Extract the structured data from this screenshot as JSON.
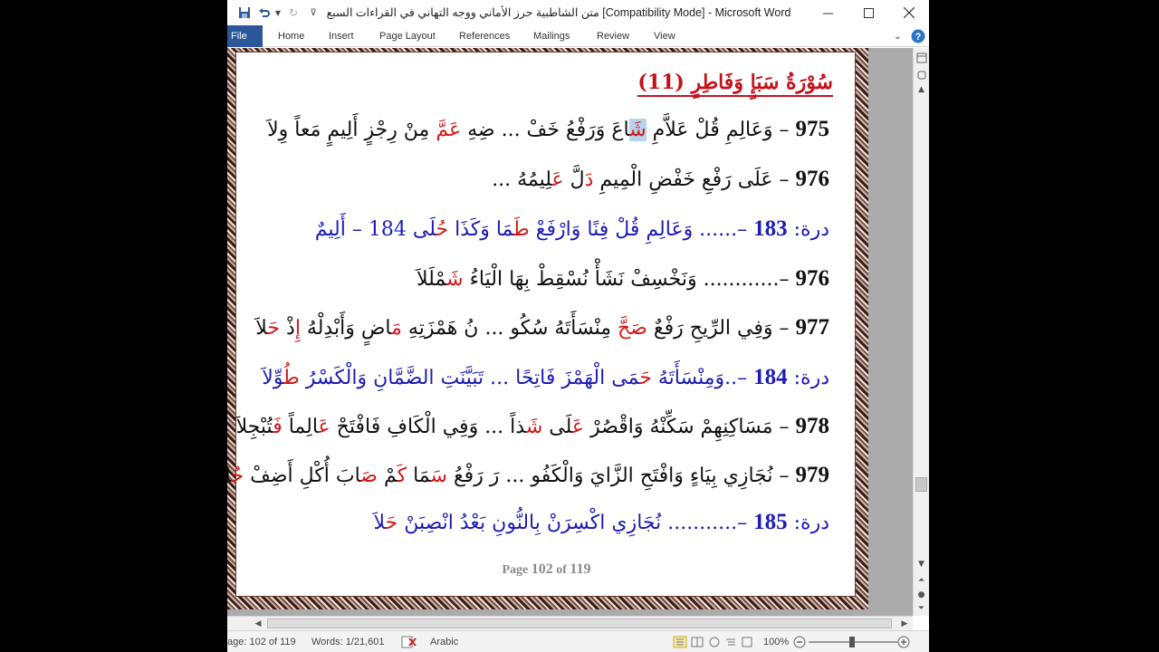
{
  "window": {
    "title": "متن الشاطبية حرز الأماني ووجه التهاني في القراءات السبع [Compatibility Mode]  -  Microsoft Word",
    "controls": {
      "minimize": "—",
      "maximize": "☐",
      "close": "✕"
    }
  },
  "ribbon": {
    "file": "File",
    "tabs": [
      "Home",
      "Insert",
      "Page Layout",
      "References",
      "Mailings",
      "Review",
      "View"
    ]
  },
  "document": {
    "heading": "سُوْرَةُ سَبَإٍ وَفَاطِرٍ (11)",
    "lines": [
      {
        "number": "975",
        "segments": [
          {
            "t": " – وَعَالِمِ قُلْ عَلاَّمِ ",
            "c": "black"
          },
          {
            "t": "شَ",
            "c": "red-hl"
          },
          {
            "t": "اعَ وَرَفْعُ خَفْ ... ضِهِ ",
            "c": "black"
          },
          {
            "t": "عَمَّ",
            "c": "red"
          },
          {
            "t": " مِنْ رِجْزٍ أَلِيمٍ مَعاً وِلاَ",
            "c": "black"
          }
        ]
      },
      {
        "number": "976",
        "segments": [
          {
            "t": " – عَلَى رَفْعِ خَفْضِ الْمِيمِ ",
            "c": "black"
          },
          {
            "t": "دَ",
            "c": "red"
          },
          {
            "t": "لَّ ",
            "c": "black"
          },
          {
            "t": "عَ",
            "c": "red"
          },
          {
            "t": "لِيمُهُ ...",
            "c": "black"
          }
        ]
      },
      {
        "number": "183",
        "prefix": "درة: ",
        "color": "blue",
        "segments": [
          {
            "t": " –...... وَعَالِمِ قُلْ فِنًا وَارْفَعْ ",
            "c": "blue"
          },
          {
            "t": "طَ",
            "c": "red"
          },
          {
            "t": "مَا وَكَذَا ",
            "c": "blue"
          },
          {
            "t": "حُ",
            "c": "red"
          },
          {
            "t": "لَى",
            "c": "blue"
          },
          {
            "t": "      184 – أَلِيمٌ",
            "c": "blue"
          }
        ]
      },
      {
        "number": "976",
        "segments": [
          {
            "t": " –............ وَنَخْسِفْ نَشَأْ نُسْقِطْ بِهَا الْيَاءُ ",
            "c": "black"
          },
          {
            "t": "شَ",
            "c": "red"
          },
          {
            "t": "مْلَلاَ",
            "c": "black"
          }
        ]
      },
      {
        "number": "977",
        "segments": [
          {
            "t": " – وَفِي الرِّيحِ رَفْعٌ ",
            "c": "black"
          },
          {
            "t": "صَحَّ",
            "c": "red"
          },
          {
            "t": " مِنْسَأَتَهُ سُكُو ... نُ هَمْزَتِهِ ",
            "c": "black"
          },
          {
            "t": "مَ",
            "c": "red"
          },
          {
            "t": "اضٍ وَأَبْدِلْهُ ",
            "c": "black"
          },
          {
            "t": "إِ",
            "c": "red"
          },
          {
            "t": "ذْ ",
            "c": "black"
          },
          {
            "t": "حَ",
            "c": "red"
          },
          {
            "t": "لاَ",
            "c": "black"
          }
        ]
      },
      {
        "number": "184",
        "prefix": "درة: ",
        "color": "blue",
        "segments": [
          {
            "t": " –..وَمِنْسَأَتَهُ ",
            "c": "blue"
          },
          {
            "t": "حَ",
            "c": "red"
          },
          {
            "t": "مَى الْهَمْزَ فَاتِحًا ... تَبَيَّنَتِ الضَّمَّانِ وَالْكَسْرُ ",
            "c": "blue"
          },
          {
            "t": "طُ",
            "c": "red"
          },
          {
            "t": "وِّلاَ",
            "c": "blue"
          }
        ]
      },
      {
        "number": "978",
        "segments": [
          {
            "t": " – مَسَاكِنِهِمْ سَكِّنْهُ وَاقْصُرْ ",
            "c": "black"
          },
          {
            "t": "عَ",
            "c": "red"
          },
          {
            "t": "لَى ",
            "c": "black"
          },
          {
            "t": "شَ",
            "c": "red"
          },
          {
            "t": "ذاً ... وَفِي الْكَافِ فَافْتَحْ ",
            "c": "black"
          },
          {
            "t": "عَ",
            "c": "red"
          },
          {
            "t": "الِماً ",
            "c": "black"
          },
          {
            "t": "فَ",
            "c": "red"
          },
          {
            "t": "تُبْجِلاَ",
            "c": "black"
          }
        ]
      },
      {
        "number": "979",
        "segments": [
          {
            "t": " – نُجَازِي بِيَاءٍ وَافْتَحِ الزَّايَ وَالْكَفُو ... رَ رَفْعُ ",
            "c": "black"
          },
          {
            "t": "سَ",
            "c": "red"
          },
          {
            "t": "مَا ",
            "c": "black"
          },
          {
            "t": "كَ",
            "c": "red"
          },
          {
            "t": "مْ ",
            "c": "black"
          },
          {
            "t": "صَ",
            "c": "red"
          },
          {
            "t": "ابَ أُكْلِ أَضِفْ ",
            "c": "black"
          },
          {
            "t": "حُ",
            "c": "red"
          },
          {
            "t": "لاَ",
            "c": "black"
          }
        ]
      },
      {
        "number": "185",
        "prefix": "درة: ",
        "color": "blue",
        "segments": [
          {
            "t": " –........... نُجَازِي اكْسِرَنْ بِالنُّونِ بَعْدُ انْصِبَنْ ",
            "c": "blue"
          },
          {
            "t": "حَ",
            "c": "red"
          },
          {
            "t": "لاَ",
            "c": "blue"
          }
        ]
      }
    ],
    "page_footer": {
      "prefix": "Page ",
      "current": "102",
      "middle": " of ",
      "total": "119"
    }
  },
  "statusbar": {
    "page": "age: 102 of 119",
    "words": "Words: 1/21,601",
    "language": "Arabic",
    "zoom": "100%"
  },
  "colors": {
    "file_tab": "#2b579a",
    "red_text": "#d11a1a",
    "blue_text": "#1d1cb4"
  }
}
